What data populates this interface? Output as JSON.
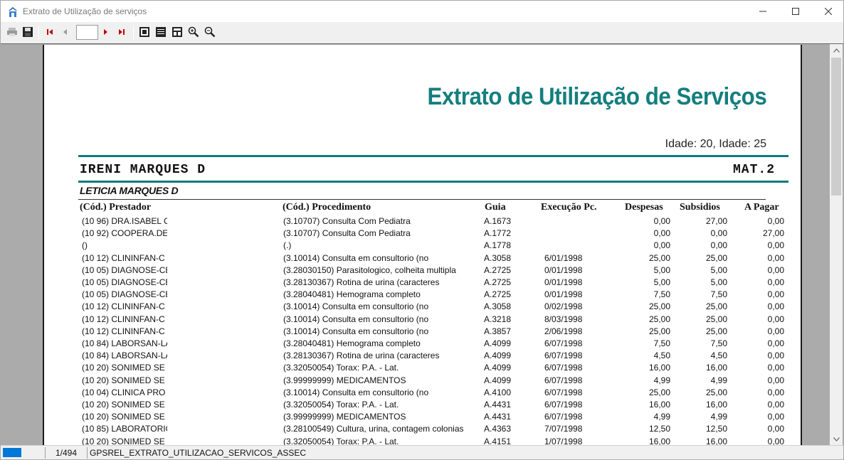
{
  "window": {
    "title": "Extrato de Utilização de serviços"
  },
  "toolbar": {
    "page_value": ""
  },
  "report": {
    "title": "Extrato de Utilização de Serviços",
    "idade_text": "Idade: 20,  Idade: 25",
    "holder": "IRENI MARQUES D",
    "mat": "MAT.2",
    "dependent": "LETICIA MARQUES D",
    "columns": {
      "prestador": "(Cód.) Prestador",
      "procedimento": "(Cód.) Procedimento",
      "guia": "Guia",
      "execucao": "Execução  Pc.",
      "despesas": "Despesas",
      "subsidios": "Subsidios",
      "a_pagar": "A Pagar"
    },
    "rows": [
      {
        "prestador": "(10      96) DRA.ISABEL C",
        "procedimento": "(3.10707) Consulta Com Pediatra",
        "guia": "A.1673",
        "execucao": "",
        "despesas": "0,00",
        "subsidios": "27,00",
        "a_pagar": "0,00"
      },
      {
        "prestador": "(10      92) COOPERA.DE",
        "procedimento": "(3.10707) Consulta Com Pediatra",
        "guia": "A.1772",
        "execucao": "",
        "despesas": "0,00",
        "subsidios": "0,00",
        "a_pagar": "27,00"
      },
      {
        "prestador": "()",
        "procedimento": "(.)",
        "guia": "A.1778",
        "execucao": "",
        "despesas": "0,00",
        "subsidios": "0,00",
        "a_pagar": "0,00"
      },
      {
        "prestador": "(10      12) CLININFAN-C",
        "procedimento": "(3.10014) Consulta em consultorio (no",
        "guia": "A.3058",
        "execucao": "6/01/1998",
        "despesas": "25,00",
        "subsidios": "25,00",
        "a_pagar": "0,00"
      },
      {
        "prestador": "(10      05) DIAGNOSE-CE",
        "procedimento": "(3.28030150) Parasitologico, colheita multipla",
        "guia": "A.2725",
        "execucao": "0/01/1998",
        "despesas": "5,00",
        "subsidios": "5,00",
        "a_pagar": "0,00"
      },
      {
        "prestador": "(10      05) DIAGNOSE-CE",
        "procedimento": "(3.28130367) Rotina de urina (caracteres",
        "guia": "A.2725",
        "execucao": "0/01/1998",
        "despesas": "5,00",
        "subsidios": "5,00",
        "a_pagar": "0,00"
      },
      {
        "prestador": "(10      05) DIAGNOSE-CE",
        "procedimento": "(3.28040481) Hemograma completo",
        "guia": "A.2725",
        "execucao": "0/01/1998",
        "despesas": "7,50",
        "subsidios": "7,50",
        "a_pagar": "0,00"
      },
      {
        "prestador": "(10      12) CLININFAN-C",
        "procedimento": "(3.10014) Consulta em consultorio (no",
        "guia": "A.3058",
        "execucao": "0/02/1998",
        "despesas": "25,00",
        "subsidios": "25,00",
        "a_pagar": "0,00"
      },
      {
        "prestador": "(10      12) CLININFAN-C",
        "procedimento": "(3.10014) Consulta em consultorio (no",
        "guia": "A.3218",
        "execucao": "8/03/1998",
        "despesas": "25,00",
        "subsidios": "25,00",
        "a_pagar": "0,00"
      },
      {
        "prestador": "(10      12) CLININFAN-C",
        "procedimento": "(3.10014) Consulta em consultorio (no",
        "guia": "A.3857",
        "execucao": "2/06/1998",
        "despesas": "25,00",
        "subsidios": "25,00",
        "a_pagar": "0,00"
      },
      {
        "prestador": "(10      84) LABORSAN-LA",
        "procedimento": "(3.28040481) Hemograma completo",
        "guia": "A.4099",
        "execucao": "6/07/1998",
        "despesas": "7,50",
        "subsidios": "7,50",
        "a_pagar": "0,00"
      },
      {
        "prestador": "(10      84) LABORSAN-LA",
        "procedimento": "(3.28130367) Rotina de urina (caracteres",
        "guia": "A.4099",
        "execucao": "6/07/1998",
        "despesas": "4,50",
        "subsidios": "4,50",
        "a_pagar": "0,00"
      },
      {
        "prestador": "(10      20)    SONIMED SE",
        "procedimento": "(3.32050054) Torax: P.A. - Lat.",
        "guia": "A.4099",
        "execucao": "6/07/1998",
        "despesas": "16,00",
        "subsidios": "16,00",
        "a_pagar": "0,00"
      },
      {
        "prestador": "(10      20)    SONIMED SE",
        "procedimento": "(3.99999999) MEDICAMENTOS",
        "guia": "A.4099",
        "execucao": "6/07/1998",
        "despesas": "4,99",
        "subsidios": "4,99",
        "a_pagar": "0,00"
      },
      {
        "prestador": "(10      04) CLINICA PRO",
        "procedimento": "(3.10014) Consulta em consultorio (no",
        "guia": "A.4100",
        "execucao": "6/07/1998",
        "despesas": "25,00",
        "subsidios": "25,00",
        "a_pagar": "0,00"
      },
      {
        "prestador": "(10      20)    SONIMED SE",
        "procedimento": "(3.32050054) Torax: P.A. - Lat.",
        "guia": "A.4431",
        "execucao": "6/07/1998",
        "despesas": "16,00",
        "subsidios": "16,00",
        "a_pagar": "0,00"
      },
      {
        "prestador": "(10      20)    SONIMED SE",
        "procedimento": "(3.99999999) MEDICAMENTOS",
        "guia": "A.4431",
        "execucao": "6/07/1998",
        "despesas": "4,99",
        "subsidios": "4,99",
        "a_pagar": "0,00"
      },
      {
        "prestador": "(10      85) LABORATORIC",
        "procedimento": "(3.28100549) Cultura, urina, contagem colonias",
        "guia": "A.4363",
        "execucao": "7/07/1998",
        "despesas": "12,50",
        "subsidios": "12,50",
        "a_pagar": "0,00"
      },
      {
        "prestador": "(10      20)    SONIMED SE",
        "procedimento": "(3.32050054) Torax: P.A. - Lat.",
        "guia": "A.4151",
        "execucao": "1/07/1998",
        "despesas": "16,00",
        "subsidios": "16,00",
        "a_pagar": "0,00"
      }
    ]
  },
  "statusbar": {
    "page": "1/494",
    "report_name": "GPSREL_EXTRATO_UTILIZACAO_SERVICOS_ASSEC"
  },
  "icons": {
    "app": "app-icon",
    "print": "printer-icon",
    "save": "save-icon",
    "first": "first-page-icon",
    "prev": "previous-page-icon",
    "next": "next-page-icon",
    "last": "last-page-icon",
    "whole_page": "whole-page-icon",
    "page_width": "page-width-icon",
    "actual_size": "actual-size-icon",
    "zoom_in": "zoom-in-icon",
    "zoom_out": "zoom-out-icon"
  },
  "colors": {
    "accent": "#147e7e",
    "progress": "#0078d7"
  }
}
